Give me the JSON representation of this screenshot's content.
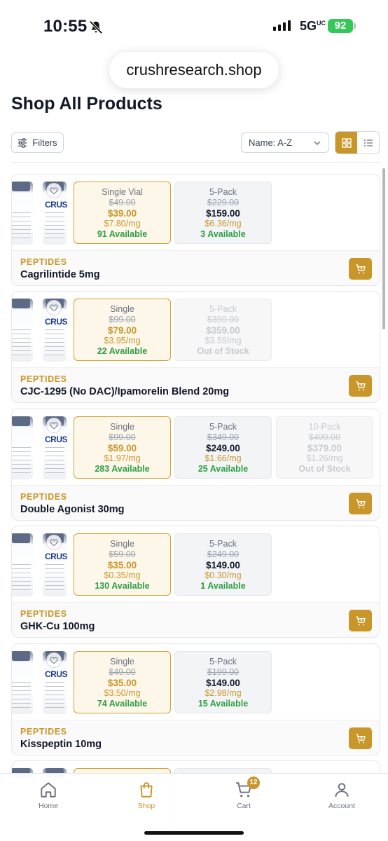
{
  "status": {
    "time": "10:55",
    "network": "5G",
    "network_sup": "UC",
    "battery": "92"
  },
  "browser": {
    "url": "crushresearch.shop"
  },
  "page": {
    "title": "Shop All Products"
  },
  "toolbar": {
    "filters_label": "Filters",
    "sort_value": "Name: A-Z"
  },
  "products": [
    {
      "category": "PEPTIDES",
      "name": "Cagrilintide 5mg",
      "vial_label": "CRUS",
      "options": [
        {
          "name": "Single Vial",
          "orig": "$49.00",
          "price": "$39.00",
          "ppm": "$7.80/mg",
          "avail": "91 Available",
          "state": "selected"
        },
        {
          "name": "5-Pack",
          "orig": "$229.00",
          "price": "$159.00",
          "ppm": "$6.36/mg",
          "avail": "3 Available",
          "state": "normal"
        }
      ]
    },
    {
      "category": "PEPTIDES",
      "name": "CJC-1295 (No DAC)/Ipamorelin Blend 20mg",
      "vial_label": "CRUS",
      "options": [
        {
          "name": "Single",
          "orig": "$99.00",
          "price": "$79.00",
          "ppm": "$3.95/mg",
          "avail": "22 Available",
          "state": "selected"
        },
        {
          "name": "5-Pack",
          "orig": "$399.00",
          "price": "$359.00",
          "ppm": "$3.59/mg",
          "avail": "Out of Stock",
          "state": "oos"
        }
      ]
    },
    {
      "category": "PEPTIDES",
      "name": "Double Agonist 30mg",
      "vial_label": "CRUS",
      "options": [
        {
          "name": "Single",
          "orig": "$99.00",
          "price": "$59.00",
          "ppm": "$1.97/mg",
          "avail": "283 Available",
          "state": "selected"
        },
        {
          "name": "5-Pack",
          "orig": "$349.00",
          "price": "$249.00",
          "ppm": "$1.66/mg",
          "avail": "25 Available",
          "state": "normal"
        },
        {
          "name": "10-Pack",
          "orig": "$499.00",
          "price": "$379.00",
          "ppm": "$1.26/mg",
          "avail": "Out of Stock",
          "state": "oos"
        }
      ]
    },
    {
      "category": "PEPTIDES",
      "name": "GHK-Cu 100mg",
      "vial_label": "CRUS",
      "options": [
        {
          "name": "Single",
          "orig": "$59.00",
          "price": "$35.00",
          "ppm": "$0.35/mg",
          "avail": "130 Available",
          "state": "selected"
        },
        {
          "name": "5-Pack",
          "orig": "$249.00",
          "price": "$149.00",
          "ppm": "$0.30/mg",
          "avail": "1 Available",
          "state": "normal"
        }
      ]
    },
    {
      "category": "PEPTIDES",
      "name": "Kisspeptin 10mg",
      "vial_label": "CRUS",
      "options": [
        {
          "name": "Single",
          "orig": "$49.00",
          "price": "$35.00",
          "ppm": "$3.50/mg",
          "avail": "74 Available",
          "state": "selected"
        },
        {
          "name": "5-Pack",
          "orig": "$199.00",
          "price": "$149.00",
          "ppm": "$2.98/mg",
          "avail": "15 Available",
          "state": "normal"
        }
      ]
    }
  ],
  "nav": {
    "home": "Home",
    "shop": "Shop",
    "cart": "Cart",
    "account": "Account",
    "cart_count": "12"
  },
  "colors": {
    "accent": "#c9962a",
    "available": "#2f9e44",
    "battery": "#34c759"
  }
}
